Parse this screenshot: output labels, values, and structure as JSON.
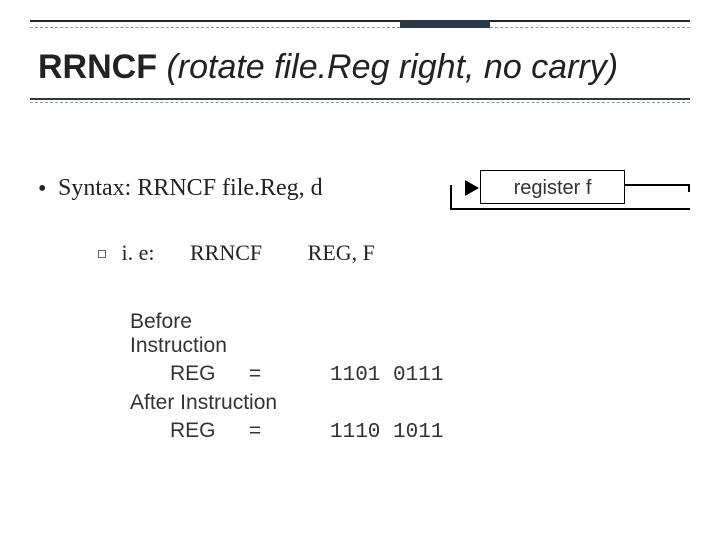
{
  "title": {
    "main": "RRNCF",
    "sub": "(rotate file.Reg right, no carry)"
  },
  "syntax_line": "Syntax: RRNCF file.Reg, d",
  "example": {
    "prefix": "i. e:",
    "mnemonic": "RRNCF",
    "operands": "REG, F"
  },
  "register_label": "register f",
  "instruction_block": {
    "before_label": "Before Instruction",
    "before_reg": "REG",
    "before_eq": "=",
    "before_val": "1101 0111",
    "after_label": "After Instruction",
    "after_reg": "REG",
    "after_eq": "=",
    "after_val": "1110 1011"
  }
}
